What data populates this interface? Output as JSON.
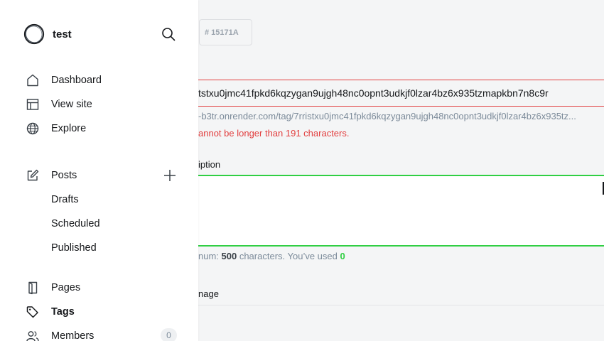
{
  "sidebar": {
    "site_title": "test",
    "nav": {
      "dashboard": "Dashboard",
      "view_site": "View site",
      "explore": "Explore",
      "posts": "Posts",
      "drafts": "Drafts",
      "scheduled": "Scheduled",
      "published": "Published",
      "pages": "Pages",
      "tags": "Tags",
      "members": "Members",
      "members_count": "0"
    },
    "icons": [
      "search-icon",
      "home-icon",
      "layout-icon",
      "globe-icon",
      "edit-icon",
      "plus-icon",
      "pages-icon",
      "tag-icon",
      "members-icon"
    ],
    "active_item": "Tags"
  },
  "main": {
    "color_value": "# 15171A",
    "slug_value": "tstxu0jmc41fpkd6kqzygan9ujgh48nc0opnt3udkjf0lzar4bz6x935tzmapkbn7n8c9r",
    "slug_url": "-b3tr.onrender.com/tag/7rristxu0jmc41fpkd6kqzygan9ujgh48nc0opnt3udkjf0lzar4bz6x935tz...",
    "slug_error": "annot be longer than 191 characters.",
    "description_label": "iption",
    "description_value": "",
    "hint_prefix": "num: ",
    "hint_max": "500",
    "hint_middle": " characters. You’ve used ",
    "hint_used": "0",
    "image_label": "nage"
  },
  "colors": {
    "error": "#e23e3e",
    "focus_green": "#30cf43",
    "text": "#15171a",
    "muted": "#7c8b9a"
  }
}
